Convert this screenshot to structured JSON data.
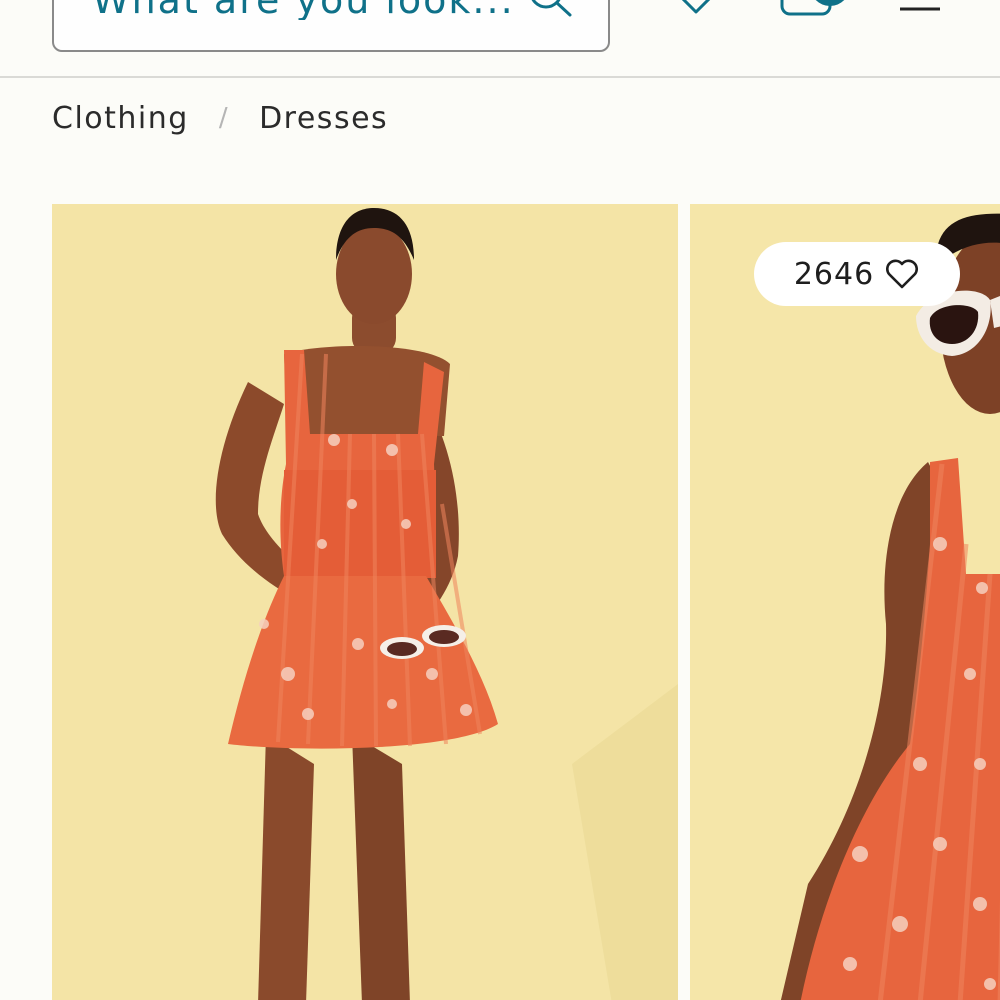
{
  "header": {
    "search": {
      "placeholder": "What are you look..."
    },
    "icons": {
      "search": "search-icon",
      "wishlist": "heart-icon",
      "bag": "bag-icon",
      "menu": "hamburger-menu-icon"
    },
    "colors": {
      "accent": "#0f7189",
      "bag_badge": "#0f7189"
    }
  },
  "breadcrumb": {
    "items": [
      {
        "label": "Clothing"
      },
      {
        "label": "Dresses"
      }
    ],
    "separator": "/"
  },
  "products": [
    {
      "image": "model in orange floral smocked mini dress holding white sunglasses",
      "background": "#f4e4a6"
    },
    {
      "image": "model in orange floral smocked dress wearing white sunglasses",
      "likes": "2646",
      "like_icon": "heart-outline-icon",
      "background": "#f5e6a9"
    }
  ]
}
